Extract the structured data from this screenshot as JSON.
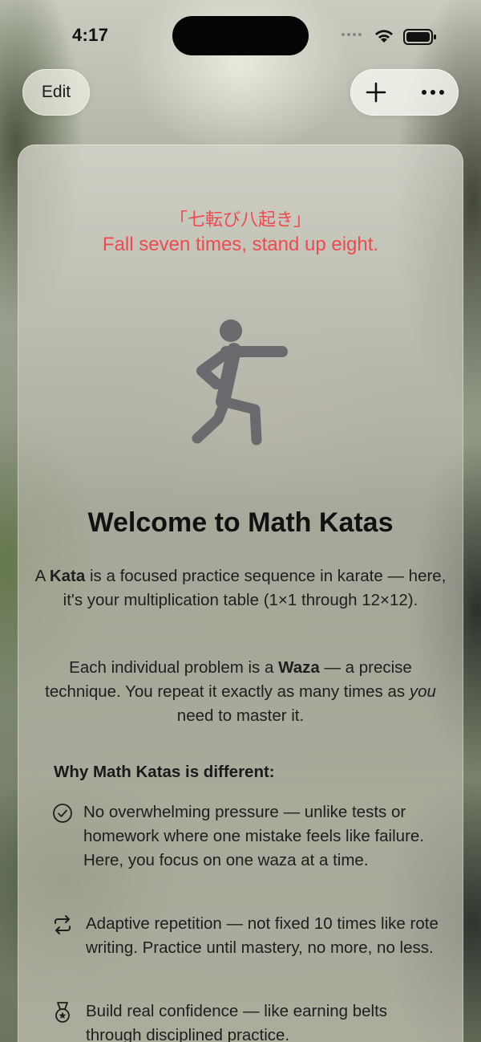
{
  "status_bar": {
    "time": "4:17"
  },
  "toolbar": {
    "edit_label": "Edit"
  },
  "card": {
    "quote_jp": "「七転び八起き」",
    "quote_en": "Fall seven times, stand up eight.",
    "title": "Welcome to Math Katas",
    "para1": {
      "pre": "A ",
      "bold": "Kata",
      "post": " is a focused practice sequence in karate — here, it's your multiplication table (1×1 through 12×12)."
    },
    "para2": {
      "pre": "Each individual problem is a ",
      "bold": "Waza",
      "mid": " — a precise technique. You repeat it exactly as many times as ",
      "italic": "you",
      "post": " need to master it."
    },
    "why_heading": "Why Math Katas is different:",
    "features": [
      {
        "icon": "checkmark-circle-icon",
        "text": "No overwhelming pressure — unlike tests or homework where one mistake feels like failure. Here, you focus on one waza at a time."
      },
      {
        "icon": "repeat-icon",
        "text": "Adaptive repetition — not fixed 10 times like rote writing. Practice until mastery, no more, no less."
      },
      {
        "icon": "medal-icon",
        "text": "Build real confidence — like earning belts through disciplined practice."
      }
    ]
  },
  "colors": {
    "accent_red": "#ef4a50",
    "figure_gray": "#6a6a6e"
  }
}
